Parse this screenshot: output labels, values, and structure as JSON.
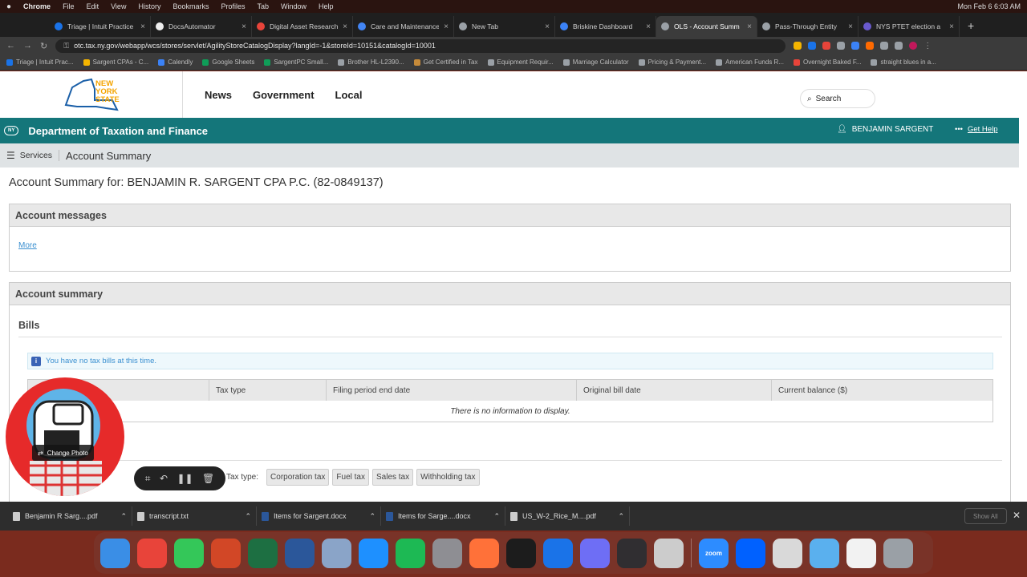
{
  "menubar": {
    "apple": "",
    "app": "Chrome",
    "items": [
      "File",
      "Edit",
      "View",
      "History",
      "Bookmarks",
      "Profiles",
      "Tab",
      "Window",
      "Help"
    ],
    "clock": "Mon Feb 6  6:03 AM"
  },
  "tabs": [
    {
      "label": "Triage | Intuit Practice",
      "color": "#1a73e8"
    },
    {
      "label": "DocsAutomator",
      "color": "#eeeeee"
    },
    {
      "label": "Digital Asset Research",
      "color": "#e8443a"
    },
    {
      "label": "Care and Maintenance",
      "color": "#4285f4"
    },
    {
      "label": "New Tab",
      "color": "#9aa0a6"
    },
    {
      "label": "Briskine Dashboard",
      "color": "#3b82f6"
    },
    {
      "label": "OLS - Account Summ",
      "color": "#9aa0a6",
      "active": true
    },
    {
      "label": "Pass-Through Entity",
      "color": "#9aa0a6"
    },
    {
      "label": "NYS PTET election a",
      "color": "#6a5acd"
    }
  ],
  "address": {
    "url": "otc.tax.ny.gov/webapp/wcs/stores/servlet/AgilityStoreCatalogDisplay?langId=-1&storeId=10151&catalogId=10001"
  },
  "bookmarks": [
    {
      "label": "Triage | Intuit Prac...",
      "color": "#1a73e8"
    },
    {
      "label": "Sargent CPAs - C...",
      "color": "#f4b400"
    },
    {
      "label": "Calendly",
      "color": "#3b82f6"
    },
    {
      "label": "Google Sheets",
      "color": "#0f9d58"
    },
    {
      "label": "SargentPC Small...",
      "color": "#0f9d58"
    },
    {
      "label": "Brother HL-L2390...",
      "color": "#9aa0a6"
    },
    {
      "label": "Get Certified in Tax",
      "color": "#c58a3a"
    },
    {
      "label": "Equipment Requir...",
      "color": "#9aa0a6"
    },
    {
      "label": "Marriage Calculator",
      "color": "#9aa0a6"
    },
    {
      "label": "Pricing & Payment...",
      "color": "#9aa0a6"
    },
    {
      "label": "American Funds R...",
      "color": "#9aa0a6"
    },
    {
      "label": "Overnight Baked F...",
      "color": "#e8443a"
    },
    {
      "label": "straight blues in a...",
      "color": "#9aa0a6"
    }
  ],
  "site": {
    "logo_line1": "NEW",
    "logo_line2": "YORK",
    "logo_line3": "STATE",
    "nav": [
      "News",
      "Government",
      "Local"
    ],
    "search_label": "Search",
    "department": "Department of Taxation and Finance",
    "user": "BENJAMIN SARGENT",
    "get_help": "Get Help",
    "services": "Services",
    "breadcrumb": "Account Summary"
  },
  "main": {
    "heading": "Account Summary for: BENJAMIN R. SARGENT CPA P.C. (82-0849137)",
    "messages_title": "Account messages",
    "more_link": "More",
    "summary_title": "Account summary",
    "bills_title": "Bills",
    "notice": "You have no tax bills at this time.",
    "table_columns": [
      "",
      "Tax type",
      "Filing period end date",
      "Original bill date",
      "Current balance ($)"
    ],
    "table_empty": "There is no information to display.",
    "filter_label": "Tax type:",
    "filter_chips": [
      "Corporation tax",
      "Fuel tax",
      "Sales tax",
      "Withholding tax"
    ]
  },
  "overlay": {
    "change_photo": "Change Photo"
  },
  "downloads": {
    "items": [
      "Benjamin R Sarg....pdf",
      "transcript.txt",
      "Items for Sargent.docx",
      "Items for Sarge....docx",
      "US_W-2_Rice_M....pdf"
    ],
    "show_all": "Show All"
  },
  "dock": {
    "zoom_label": "zoom",
    "apps": [
      {
        "name": "finder",
        "color": "#3a8ee6"
      },
      {
        "name": "chrome",
        "color": "#e8443a"
      },
      {
        "name": "messages",
        "color": "#34c759"
      },
      {
        "name": "powerpoint",
        "color": "#d24726"
      },
      {
        "name": "excel",
        "color": "#1d6f42"
      },
      {
        "name": "word",
        "color": "#2b579a"
      },
      {
        "name": "preview",
        "color": "#8aa4c8"
      },
      {
        "name": "app-store",
        "color": "#1e90ff"
      },
      {
        "name": "spotify",
        "color": "#1db954"
      },
      {
        "name": "system-preferences",
        "color": "#8e8e93"
      },
      {
        "name": "firefox",
        "color": "#ff7139"
      },
      {
        "name": "activity-monitor",
        "color": "#1c1c1c"
      },
      {
        "name": "docs-app",
        "color": "#1a73e8"
      },
      {
        "name": "flower-app",
        "color": "#6e6ef5"
      },
      {
        "name": "obs",
        "color": "#302e31"
      },
      {
        "name": "remote-desktop",
        "color": "#cccccc"
      },
      {
        "name": "zoom",
        "color": "#2d8cff"
      },
      {
        "name": "dropbox",
        "color": "#0061ff"
      },
      {
        "name": "script-editor",
        "color": "#d9d9d9"
      },
      {
        "name": "folder",
        "color": "#5ab0ee"
      },
      {
        "name": "text-file",
        "color": "#f2f2f2"
      },
      {
        "name": "trash",
        "color": "#9aa0a6"
      }
    ]
  }
}
